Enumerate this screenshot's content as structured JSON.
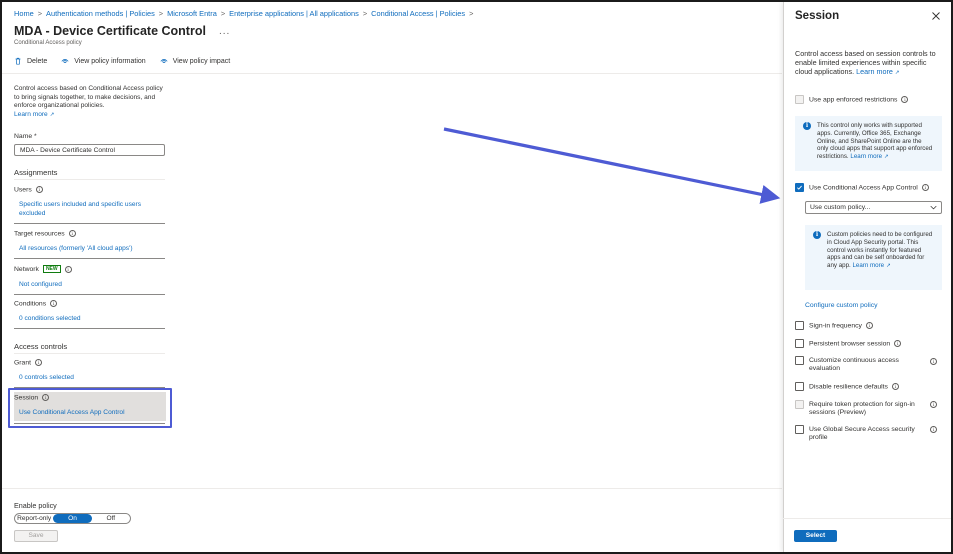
{
  "breadcrumb": [
    "Home",
    "Authentication methods | Policies",
    "Microsoft Entra",
    "Enterprise applications | All applications",
    "Conditional Access | Policies"
  ],
  "breadcrumb_sep": ">",
  "page": {
    "title": "MDA - Device Certificate Control",
    "ellipsis": "...",
    "subtitle": "Conditional Access policy"
  },
  "toolbar": {
    "delete": "Delete",
    "view_info": "View policy information",
    "view_impact": "View policy impact"
  },
  "intro": {
    "text": "Control access based on Conditional Access policy to bring signals together, to make decisions, and enforce organizational policies.",
    "learn_more": "Learn more"
  },
  "name_field": {
    "label": "Name *",
    "value": "MDA - Device Certificate Control"
  },
  "assignments": {
    "heading": "Assignments",
    "users_label": "Users",
    "users_value": "Specific users included and specific users excluded",
    "target_label": "Target resources",
    "target_value": "All resources (formerly 'All cloud apps')",
    "network_label": "Network",
    "network_badge": "NEW",
    "network_value": "Not configured",
    "conditions_label": "Conditions",
    "conditions_value": "0 conditions selected"
  },
  "access_controls": {
    "heading": "Access controls",
    "grant_label": "Grant",
    "grant_value": "0 controls selected",
    "session_label": "Session",
    "session_value": "Use Conditional Access App Control"
  },
  "enable_policy": {
    "label": "Enable policy",
    "options": [
      "Report-only",
      "On",
      "Off"
    ],
    "selected": "On",
    "save": "Save"
  },
  "session_panel": {
    "title": "Session",
    "description": "Control access based on session controls to enable limited experiences within specific cloud applications.",
    "learn_more": "Learn more",
    "app_enforced": {
      "label": "Use app enforced restrictions",
      "checked": false,
      "disabled": true
    },
    "app_enforced_info": {
      "text": "This control only works with supported apps. Currently, Office 365, Exchange Online, and SharePoint Online are the only cloud apps that support app enforced restrictions.",
      "learn_more": "Learn more"
    },
    "caac": {
      "label": "Use Conditional Access App Control",
      "checked": true
    },
    "caac_dropdown": "Use custom policy...",
    "caac_info": {
      "text": "Custom policies need to be configured in Cloud App Security portal. This control works instantly for featured apps and can be self onboarded for any app.",
      "learn_more": "Learn more"
    },
    "configure_link": "Configure custom policy",
    "options": [
      {
        "label": "Sign-in frequency",
        "checked": false,
        "disabled": false
      },
      {
        "label": "Persistent browser session",
        "checked": false,
        "disabled": false
      },
      {
        "label": "Customize continuous access evaluation",
        "checked": false,
        "disabled": false
      },
      {
        "label": "Disable resilience defaults",
        "checked": false,
        "disabled": false
      },
      {
        "label": "Require token protection for sign-in sessions (Preview)",
        "checked": false,
        "disabled": true
      },
      {
        "label": "Use Global Secure Access security profile",
        "checked": false,
        "disabled": false
      }
    ],
    "select_button": "Select"
  },
  "colors": {
    "accent": "#0f6cbd",
    "annotation": "#4e5bd4"
  }
}
